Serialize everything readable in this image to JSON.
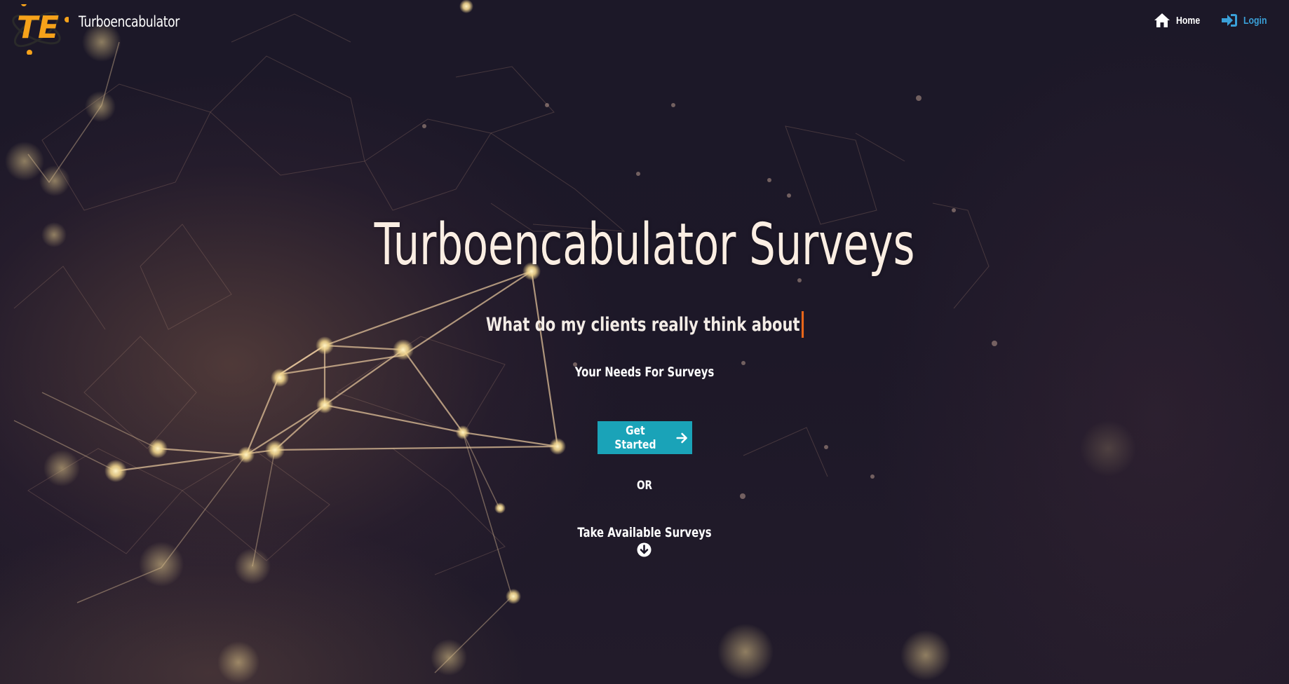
{
  "navbar": {
    "brand_logo_text": "TE",
    "brand_name": "Turboencabulator",
    "links": [
      {
        "label": "Home",
        "icon": "home-icon"
      },
      {
        "label": "Login",
        "icon": "sign-in-icon"
      }
    ]
  },
  "hero": {
    "title": "Turboencabulator Surveys",
    "typed_text": "What do my clients really think about",
    "subtitle": "Your Needs For Surveys",
    "get_started_label": "Get Started",
    "or_label": "OR",
    "take_surveys_label": "Take Available Surveys"
  },
  "colors": {
    "background": "#1b1727",
    "accent_button": "#1aa3b8",
    "login_link": "#3aa0d8",
    "logo_orange": "#f6a21a",
    "cursor": "#e8661a",
    "network_glow": "#f3d99a"
  },
  "icons": [
    "home-icon",
    "sign-in-icon",
    "arrow-right-icon",
    "arrow-circle-down-icon",
    "atom-logo-icon"
  ]
}
